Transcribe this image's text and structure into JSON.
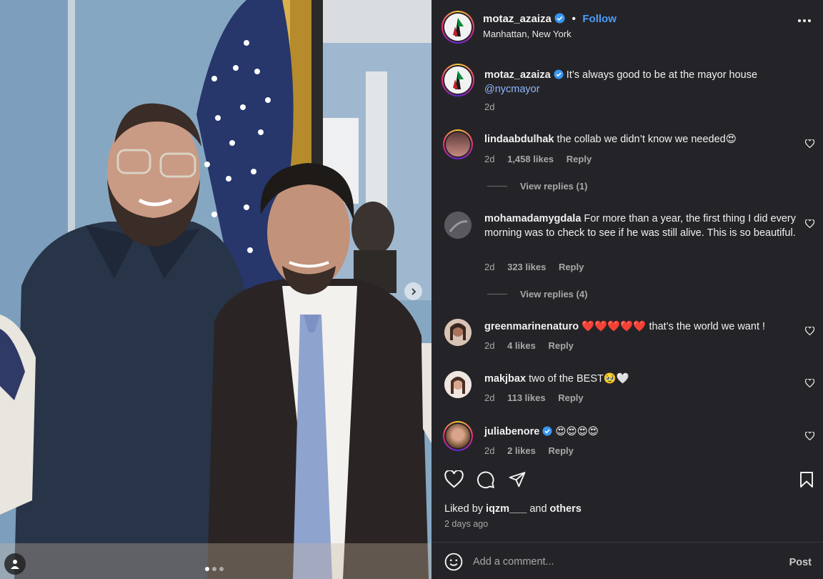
{
  "post": {
    "author": "motaz_azaiza",
    "follow_label": "Follow",
    "separator": "•",
    "location": "Manhattan, New York",
    "caption_text": "It’s always good to be at the mayor house",
    "caption_mention": "@nycmayor",
    "caption_age": "2d",
    "carousel_pages": 3
  },
  "comments": [
    {
      "user": "lindaabdulhak",
      "text": "the collab we didn’t know we needed😍",
      "age": "2d",
      "likes": "1,458 likes",
      "reply": "Reply",
      "view_replies": "View replies (1)",
      "verified": false
    },
    {
      "user": "mohamadamygdala",
      "text": "For more than a year, the first thing I did every morning was to check to see if he was still alive. This is so beautiful.",
      "age": "2d",
      "likes": "323 likes",
      "reply": "Reply",
      "view_replies": "View replies (4)",
      "verified": false
    },
    {
      "user": "greenmarinenaturo",
      "text": "❤️❤️❤️❤️❤️ that’s the world we want !",
      "age": "2d",
      "likes": "4 likes",
      "reply": "Reply",
      "verified": false
    },
    {
      "user": "makjbax",
      "text": "two of the BEST🥹🤍",
      "age": "2d",
      "likes": "113 likes",
      "reply": "Reply",
      "verified": false
    },
    {
      "user": "juliabenore",
      "text": "😍😍😍😍",
      "age": "2d",
      "likes": "2 likes",
      "reply": "Reply",
      "verified": true
    }
  ],
  "footer": {
    "liked_by_prefix": "Liked by",
    "liked_by_user": "iqzm___",
    "liked_by_and": "and",
    "liked_by_others": "others",
    "ago": "2 days ago",
    "comment_placeholder": "Add a comment...",
    "post_label": "Post"
  },
  "icons": {
    "heart": "heart-icon",
    "comment": "comment-icon",
    "share": "share-icon",
    "save": "bookmark-icon",
    "verified": "verified-badge-icon",
    "more": "more-options-icon",
    "emoji": "emoji-icon",
    "next": "chevron-right-icon",
    "tag": "user-tag-icon"
  },
  "colors": {
    "panel_bg": "#242428",
    "link_blue": "#4a9eff",
    "verified_blue": "#3897f0",
    "text_secondary": "#a8a8a8"
  }
}
